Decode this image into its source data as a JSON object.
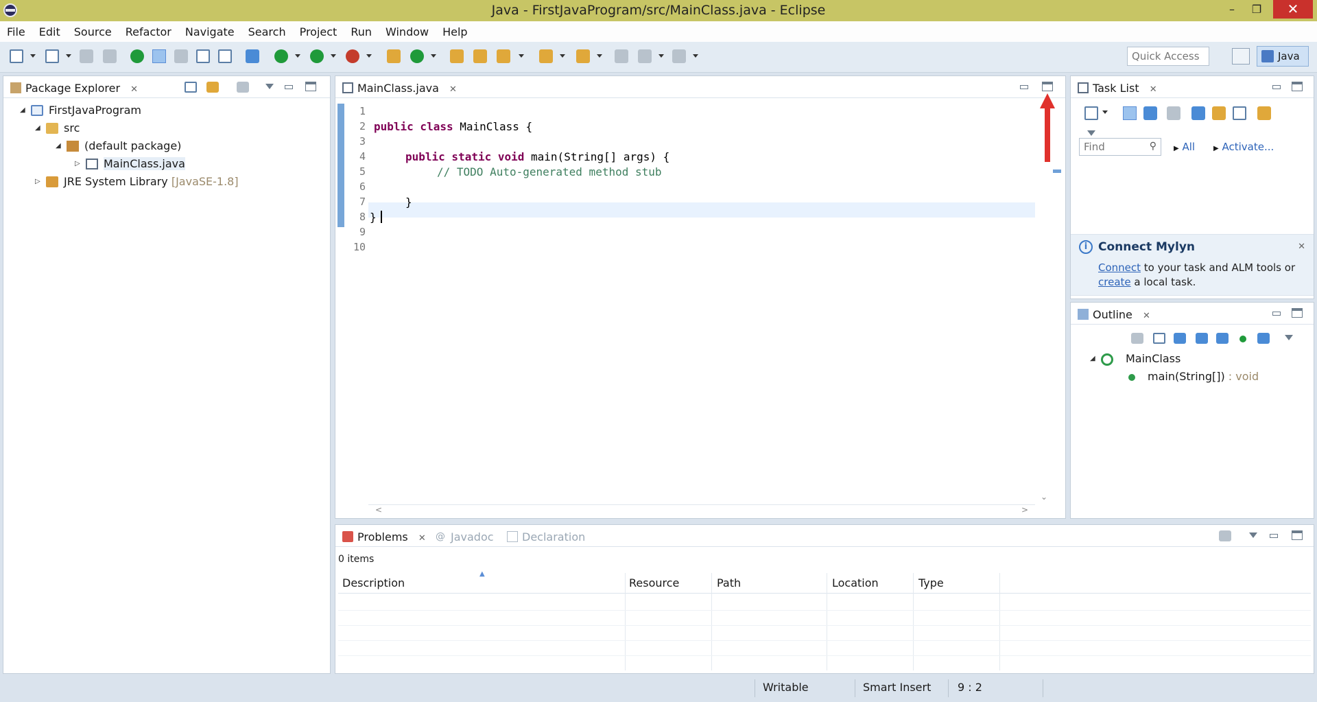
{
  "window": {
    "title": "Java - FirstJavaProgram/src/MainClass.java - Eclipse",
    "minimize": "–",
    "restore": "❐",
    "close": "✕"
  },
  "menu": [
    "File",
    "Edit",
    "Source",
    "Refactor",
    "Navigate",
    "Search",
    "Project",
    "Run",
    "Window",
    "Help"
  ],
  "toolbar": {
    "quick_access_placeholder": "Quick Access",
    "perspective_label": "Java"
  },
  "package_explorer": {
    "tab_label": "Package Explorer",
    "tree": {
      "project": "FirstJavaProgram",
      "src": "src",
      "package": "(default package)",
      "file": "MainClass.java",
      "library": "JRE System Library",
      "library_version": "[JavaSE-1.8]"
    }
  },
  "editor": {
    "tab_label": "MainClass.java",
    "line_numbers": [
      "1",
      "2",
      "3",
      "4",
      "5",
      "6",
      "7",
      "8",
      "9",
      "10"
    ],
    "code": {
      "l2_kw": "public class",
      "l2_rest": " MainClass {",
      "l4_kw": "public static void",
      "l4_rest": " main(String[] args) {",
      "l5_comment": "// TODO Auto-generated method stub",
      "l7": "}",
      "l9": "}"
    },
    "hscroll_left": "<",
    "hscroll_right": ">",
    "vscroll_down": "⌄"
  },
  "task_list": {
    "tab_label": "Task List",
    "find_placeholder": "Find",
    "all_link": "All",
    "activate_link": "Activate...",
    "connect_mylyn": {
      "title": "Connect Mylyn",
      "connect_link": "Connect",
      "text1": " to your task and ALM tools or",
      "create_link": "create",
      "text2": " a local task."
    }
  },
  "outline": {
    "tab_label": "Outline",
    "class_name": "MainClass",
    "method_name": "main(String[])",
    "method_type": " : void"
  },
  "bottom_panel": {
    "tabs": {
      "problems": "Problems",
      "javadoc": "Javadoc",
      "declaration": "Declaration"
    },
    "items_count": "0 items",
    "columns": [
      "Description",
      "Resource",
      "Path",
      "Location",
      "Type"
    ]
  },
  "status_bar": {
    "writable": "Writable",
    "insert_mode": "Smart Insert",
    "position": "9 : 2"
  },
  "colors": {
    "title_bar": "#c7c565",
    "keyword": "#7f0055",
    "comment": "#3f7f5f",
    "annotation_arrow": "#e0312c"
  }
}
